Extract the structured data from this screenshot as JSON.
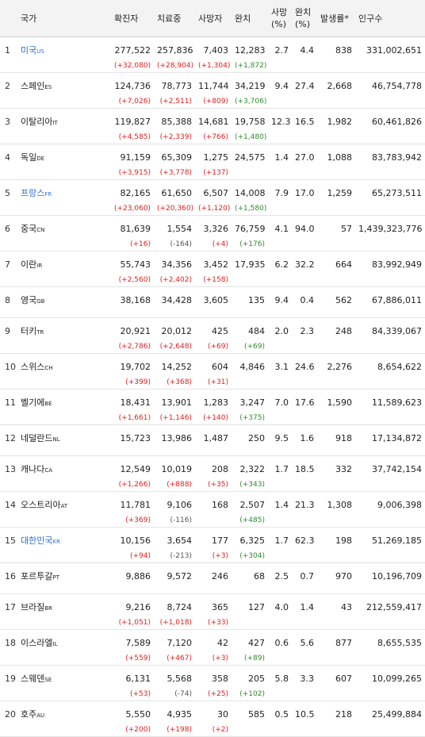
{
  "headers": {
    "country": "국가",
    "confirmed": "확진자",
    "treating": "치료중",
    "deaths": "사망자",
    "recovered": "완치",
    "death_rate": [
      "사망",
      "(%)"
    ],
    "recovery_rate": [
      "완치",
      "(%)"
    ],
    "incidence": "발생률*",
    "population": "인구수"
  },
  "rows": [
    {
      "rank": "1",
      "country": "미국",
      "code": "US",
      "link": true,
      "confirmed": "277,522",
      "confirmed_delta": "(+32,080)",
      "treating": "257,836",
      "treating_delta": "(+28,904)",
      "deaths": "7,403",
      "deaths_delta": "(+1,304)",
      "recovered": "12,283",
      "recovered_delta": "(+1,872)",
      "death_rate": "2.7",
      "recovery_rate": "4.4",
      "incidence": "838",
      "population": "331,002,651"
    },
    {
      "rank": "2",
      "country": "스페인",
      "code": "ES",
      "link": false,
      "confirmed": "124,736",
      "confirmed_delta": "(+7,026)",
      "treating": "78,773",
      "treating_delta": "(+2,511)",
      "deaths": "11,744",
      "deaths_delta": "(+809)",
      "recovered": "34,219",
      "recovered_delta": "(+3,706)",
      "death_rate": "9.4",
      "recovery_rate": "27.4",
      "incidence": "2,668",
      "population": "46,754,778"
    },
    {
      "rank": "3",
      "country": "이탈리아",
      "code": "IT",
      "link": false,
      "confirmed": "119,827",
      "confirmed_delta": "(+4,585)",
      "treating": "85,388",
      "treating_delta": "(+2,339)",
      "deaths": "14,681",
      "deaths_delta": "(+766)",
      "recovered": "19,758",
      "recovered_delta": "(+1,480)",
      "death_rate": "12.3",
      "recovery_rate": "16.5",
      "incidence": "1,982",
      "population": "60,461,826"
    },
    {
      "rank": "4",
      "country": "독일",
      "code": "DE",
      "link": false,
      "confirmed": "91,159",
      "confirmed_delta": "(+3,915)",
      "treating": "65,309",
      "treating_delta": "(+3,778)",
      "deaths": "1,275",
      "deaths_delta": "(+137)",
      "recovered": "24,575",
      "recovered_delta": "",
      "death_rate": "1.4",
      "recovery_rate": "27.0",
      "incidence": "1,088",
      "population": "83,783,942"
    },
    {
      "rank": "5",
      "country": "프랑스",
      "code": "FR",
      "link": true,
      "confirmed": "82,165",
      "confirmed_delta": "(+23,060)",
      "treating": "61,650",
      "treating_delta": "(+20,360)",
      "deaths": "6,507",
      "deaths_delta": "(+1,120)",
      "recovered": "14,008",
      "recovered_delta": "(+1,580)",
      "death_rate": "7.9",
      "recovery_rate": "17.0",
      "incidence": "1,259",
      "population": "65,273,511"
    },
    {
      "rank": "6",
      "country": "중국",
      "code": "CN",
      "link": false,
      "confirmed": "81,639",
      "confirmed_delta": "(+16)",
      "treating": "1,554",
      "treating_delta": "(-164)",
      "deaths": "3,326",
      "deaths_delta": "(+4)",
      "recovered": "76,759",
      "recovered_delta": "(+176)",
      "death_rate": "4.1",
      "recovery_rate": "94.0",
      "incidence": "57",
      "population": "1,439,323,776"
    },
    {
      "rank": "7",
      "country": "이란",
      "code": "IR",
      "link": false,
      "confirmed": "55,743",
      "confirmed_delta": "(+2,560)",
      "treating": "34,356",
      "treating_delta": "(+2,402)",
      "deaths": "3,452",
      "deaths_delta": "(+158)",
      "recovered": "17,935",
      "recovered_delta": "",
      "death_rate": "6.2",
      "recovery_rate": "32.2",
      "incidence": "664",
      "population": "83,992,949"
    },
    {
      "rank": "8",
      "country": "영국",
      "code": "GB",
      "link": false,
      "confirmed": "38,168",
      "confirmed_delta": "",
      "treating": "34,428",
      "treating_delta": "",
      "deaths": "3,605",
      "deaths_delta": "",
      "recovered": "135",
      "recovered_delta": "",
      "death_rate": "9.4",
      "recovery_rate": "0.4",
      "incidence": "562",
      "population": "67,886,011"
    },
    {
      "rank": "9",
      "country": "터키",
      "code": "TR",
      "link": false,
      "confirmed": "20,921",
      "confirmed_delta": "(+2,786)",
      "treating": "20,012",
      "treating_delta": "(+2,648)",
      "deaths": "425",
      "deaths_delta": "(+69)",
      "recovered": "484",
      "recovered_delta": "(+69)",
      "death_rate": "2.0",
      "recovery_rate": "2.3",
      "incidence": "248",
      "population": "84,339,067"
    },
    {
      "rank": "10",
      "country": "스위스",
      "code": "CH",
      "link": false,
      "confirmed": "19,702",
      "confirmed_delta": "(+399)",
      "treating": "14,252",
      "treating_delta": "(+368)",
      "deaths": "604",
      "deaths_delta": "(+31)",
      "recovered": "4,846",
      "recovered_delta": "",
      "death_rate": "3.1",
      "recovery_rate": "24.6",
      "incidence": "2,276",
      "population": "8,654,622"
    },
    {
      "rank": "11",
      "country": "벨기에",
      "code": "BE",
      "link": false,
      "confirmed": "18,431",
      "confirmed_delta": "(+1,661)",
      "treating": "13,901",
      "treating_delta": "(+1,146)",
      "deaths": "1,283",
      "deaths_delta": "(+140)",
      "recovered": "3,247",
      "recovered_delta": "(+375)",
      "death_rate": "7.0",
      "recovery_rate": "17.6",
      "incidence": "1,590",
      "population": "11,589,623"
    },
    {
      "rank": "12",
      "country": "네덜란드",
      "code": "NL",
      "link": false,
      "confirmed": "15,723",
      "confirmed_delta": "",
      "treating": "13,986",
      "treating_delta": "",
      "deaths": "1,487",
      "deaths_delta": "",
      "recovered": "250",
      "recovered_delta": "",
      "death_rate": "9.5",
      "recovery_rate": "1.6",
      "incidence": "918",
      "population": "17,134,872"
    },
    {
      "rank": "13",
      "country": "캐나다",
      "code": "CA",
      "link": false,
      "confirmed": "12,549",
      "confirmed_delta": "(+1,266)",
      "treating": "10,019",
      "treating_delta": "(+888)",
      "deaths": "208",
      "deaths_delta": "(+35)",
      "recovered": "2,322",
      "recovered_delta": "(+343)",
      "death_rate": "1.7",
      "recovery_rate": "18.5",
      "incidence": "332",
      "population": "37,742,154"
    },
    {
      "rank": "14",
      "country": "오스트리아",
      "code": "AT",
      "link": false,
      "confirmed": "11,781",
      "confirmed_delta": "(+369)",
      "treating": "9,106",
      "treating_delta": "(-116)",
      "deaths": "168",
      "deaths_delta": "",
      "recovered": "2,507",
      "recovered_delta": "(+485)",
      "death_rate": "1.4",
      "recovery_rate": "21.3",
      "incidence": "1,308",
      "population": "9,006,398"
    },
    {
      "rank": "15",
      "country": "대한민국",
      "code": "KR",
      "link": true,
      "confirmed": "10,156",
      "confirmed_delta": "(+94)",
      "treating": "3,654",
      "treating_delta": "(-213)",
      "deaths": "177",
      "deaths_delta": "(+3)",
      "recovered": "6,325",
      "recovered_delta": "(+304)",
      "death_rate": "1.7",
      "recovery_rate": "62.3",
      "incidence": "198",
      "population": "51,269,185"
    },
    {
      "rank": "16",
      "country": "포르투갈",
      "code": "PT",
      "link": false,
      "confirmed": "9,886",
      "confirmed_delta": "",
      "treating": "9,572",
      "treating_delta": "",
      "deaths": "246",
      "deaths_delta": "",
      "recovered": "68",
      "recovered_delta": "",
      "death_rate": "2.5",
      "recovery_rate": "0.7",
      "incidence": "970",
      "population": "10,196,709"
    },
    {
      "rank": "17",
      "country": "브라질",
      "code": "BR",
      "link": false,
      "confirmed": "9,216",
      "confirmed_delta": "(+1,051)",
      "treating": "8,724",
      "treating_delta": "(+1,018)",
      "deaths": "365",
      "deaths_delta": "(+33)",
      "recovered": "127",
      "recovered_delta": "",
      "death_rate": "4.0",
      "recovery_rate": "1.4",
      "incidence": "43",
      "population": "212,559,417"
    },
    {
      "rank": "18",
      "country": "이스라엘",
      "code": "IL",
      "link": false,
      "confirmed": "7,589",
      "confirmed_delta": "(+559)",
      "treating": "7,120",
      "treating_delta": "(+467)",
      "deaths": "42",
      "deaths_delta": "(+3)",
      "recovered": "427",
      "recovered_delta": "(+89)",
      "death_rate": "0.6",
      "recovery_rate": "5.6",
      "incidence": "877",
      "population": "8,655,535"
    },
    {
      "rank": "19",
      "country": "스웨덴",
      "code": "SE",
      "link": false,
      "confirmed": "6,131",
      "confirmed_delta": "(+53)",
      "treating": "5,568",
      "treating_delta": "(-74)",
      "deaths": "358",
      "deaths_delta": "(+25)",
      "recovered": "205",
      "recovered_delta": "(+102)",
      "death_rate": "5.8",
      "recovery_rate": "3.3",
      "incidence": "607",
      "population": "10,099,265"
    },
    {
      "rank": "20",
      "country": "호주",
      "code": "AU",
      "link": false,
      "confirmed": "5,550",
      "confirmed_delta": "(+200)",
      "treating": "4,935",
      "treating_delta": "(+198)",
      "deaths": "30",
      "deaths_delta": "(+2)",
      "recovered": "585",
      "recovered_delta": "",
      "death_rate": "0.5",
      "recovery_rate": "10.5",
      "incidence": "218",
      "population": "25,499,884"
    }
  ]
}
